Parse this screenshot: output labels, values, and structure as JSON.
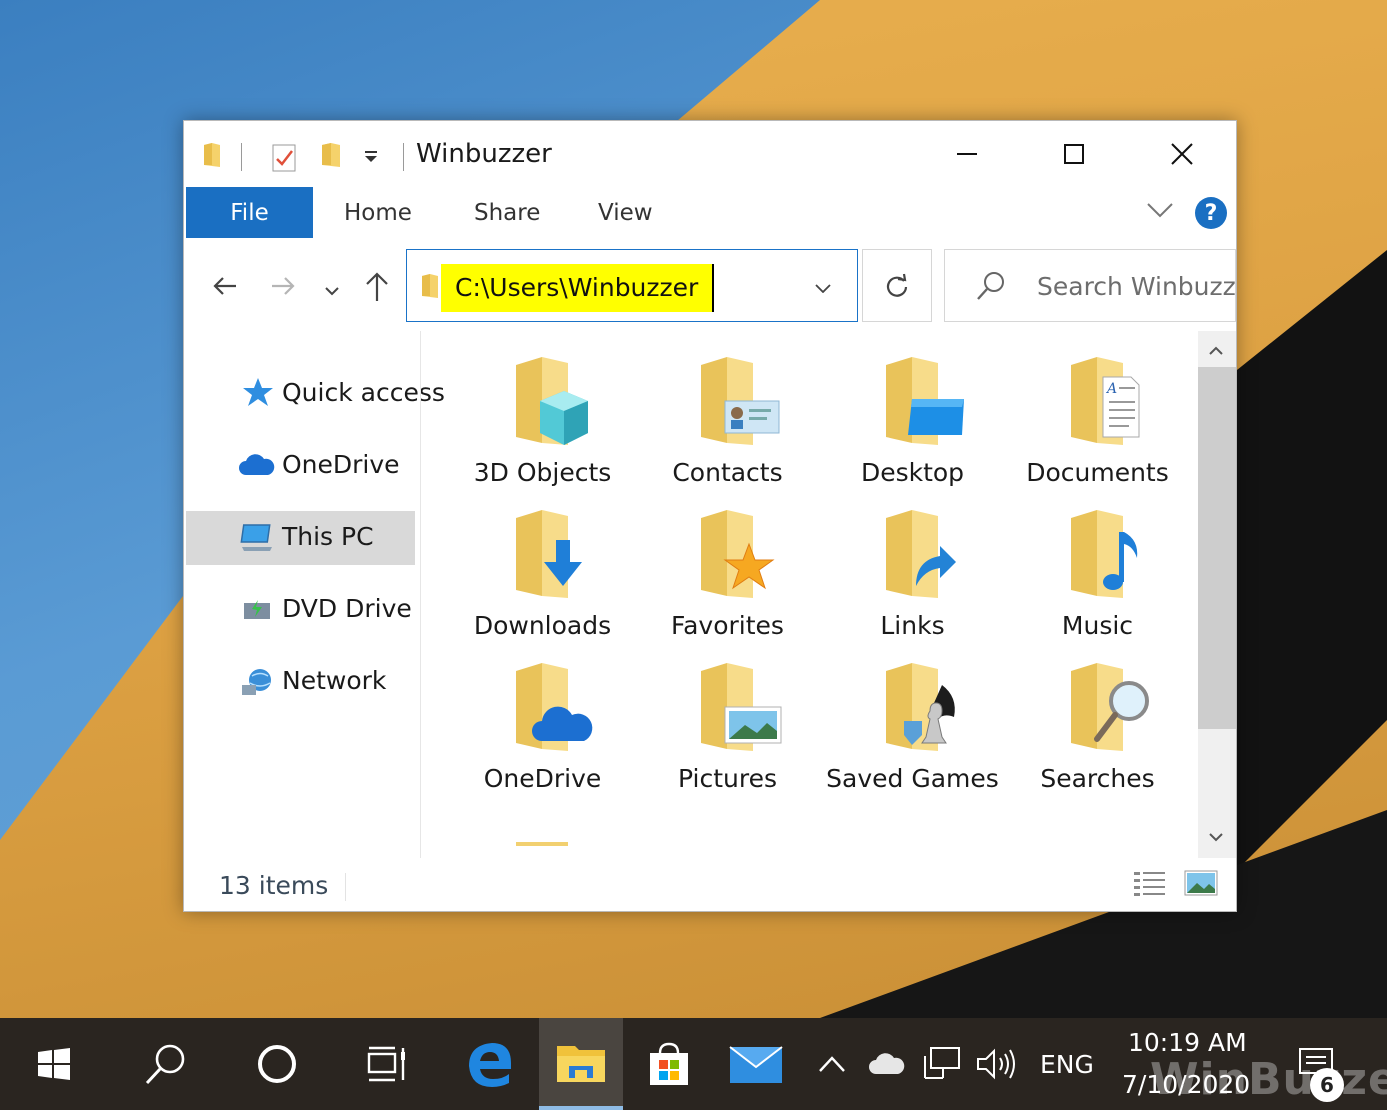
{
  "window": {
    "title": "Winbuzzer",
    "ribbon_tabs": {
      "file": "File",
      "home": "Home",
      "share": "Share",
      "view": "View"
    },
    "help": "?"
  },
  "address_bar": {
    "path": "C:\\Users\\Winbuzzer"
  },
  "search": {
    "placeholder": "Search Winbuzzer"
  },
  "nav_pane": {
    "items": [
      {
        "label": "Quick access",
        "icon": "star-icon",
        "selected": false
      },
      {
        "label": "OneDrive",
        "icon": "cloud-icon",
        "selected": false
      },
      {
        "label": "This PC",
        "icon": "computer-icon",
        "selected": true
      },
      {
        "label": "DVD Drive",
        "icon": "dvd-drive-icon",
        "selected": false
      },
      {
        "label": "Network",
        "icon": "network-icon",
        "selected": false
      }
    ]
  },
  "folders": [
    {
      "label": "3D Objects",
      "icon": "3d-objects-folder-icon"
    },
    {
      "label": "Contacts",
      "icon": "contacts-folder-icon"
    },
    {
      "label": "Desktop",
      "icon": "desktop-folder-icon"
    },
    {
      "label": "Documents",
      "icon": "documents-folder-icon"
    },
    {
      "label": "Downloads",
      "icon": "downloads-folder-icon"
    },
    {
      "label": "Favorites",
      "icon": "favorites-folder-icon"
    },
    {
      "label": "Links",
      "icon": "links-folder-icon"
    },
    {
      "label": "Music",
      "icon": "music-folder-icon"
    },
    {
      "label": "OneDrive",
      "icon": "onedrive-folder-icon"
    },
    {
      "label": "Pictures",
      "icon": "pictures-folder-icon"
    },
    {
      "label": "Saved Games",
      "icon": "saved-games-folder-icon"
    },
    {
      "label": "Searches",
      "icon": "searches-folder-icon"
    }
  ],
  "status_bar": {
    "item_count": "13 items"
  },
  "taskbar": {
    "language": "ENG",
    "time": "10:19 AM",
    "date": "7/10/2020",
    "notification_count": "6",
    "watermark": "WinBuzzer"
  },
  "colors": {
    "accent": "#1a6fc2",
    "highlight": "#ffff00",
    "folder": "#f5d26b",
    "taskbar": "#2a2520"
  }
}
